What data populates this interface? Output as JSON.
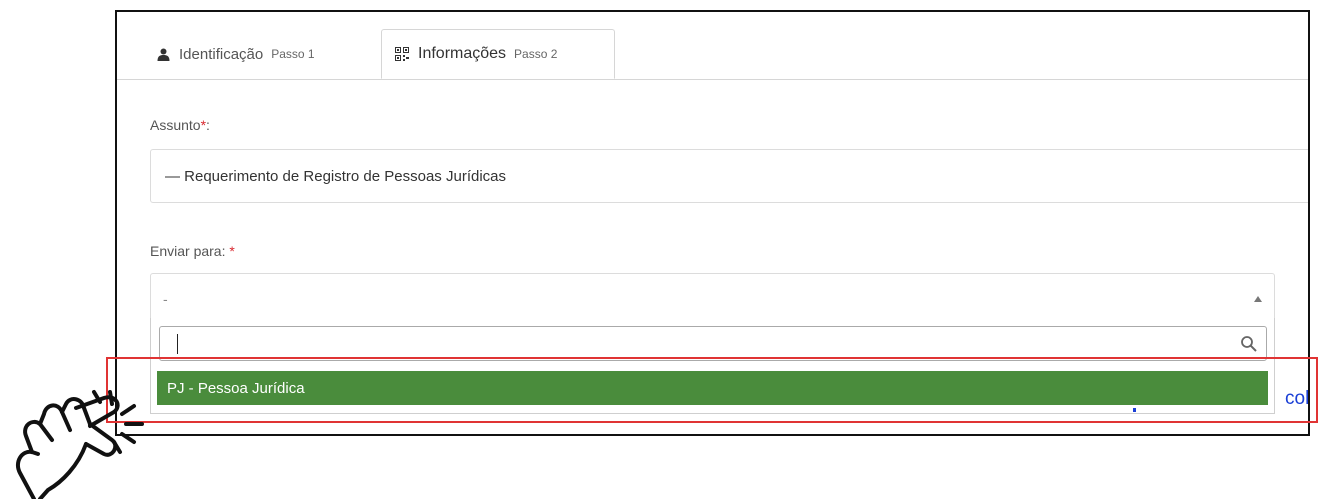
{
  "tabs": [
    {
      "label": "Identificação",
      "step": "Passo 1",
      "icon": "user-icon",
      "active": false
    },
    {
      "label": "Informações",
      "step": "Passo 2",
      "icon": "qrcode-icon",
      "active": true
    }
  ],
  "assunto": {
    "label": "Assunto",
    "required_mark": "*",
    "suffix": ":",
    "value": "— Requerimento de Registro de Pessoas Jurídicas"
  },
  "enviar": {
    "label": "Enviar para:",
    "required_mark": "*",
    "selected": "-",
    "search_value": "",
    "options": [
      "PJ - Pessoa Jurídica"
    ]
  },
  "background_fragment": "col",
  "colors": {
    "highlight_option": "#4a8c3c",
    "annotation_box": "#e03434",
    "required": "#d9282f",
    "link_text": "#1a3fd6"
  },
  "annotation_icon": "pointing-hand-click-icon"
}
